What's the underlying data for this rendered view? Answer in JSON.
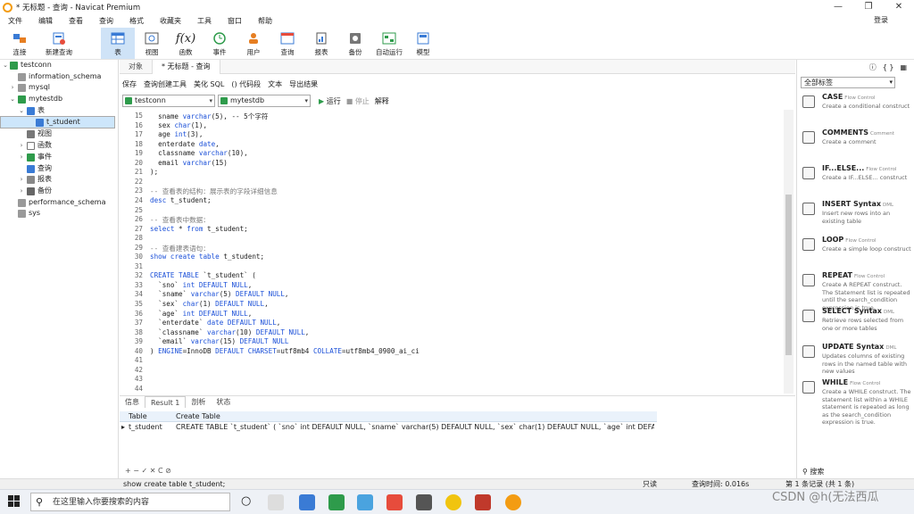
{
  "window": {
    "title": "* 无标题 - 查询 - Navicat Premium",
    "min": "—",
    "max": "❐",
    "close": "✕"
  },
  "menu": {
    "items": [
      "文件",
      "编辑",
      "查看",
      "查询",
      "格式",
      "收藏夹",
      "工具",
      "窗口",
      "帮助"
    ],
    "login": "登录"
  },
  "toolbar": {
    "items": [
      {
        "label": "连接",
        "icon": "connect-icon"
      },
      {
        "label": "新建查询",
        "icon": "new-query-icon"
      },
      {
        "label": "表",
        "icon": "table-icon"
      },
      {
        "label": "视图",
        "icon": "view-icon"
      },
      {
        "label": "函数",
        "icon": "function-icon"
      },
      {
        "label": "事件",
        "icon": "event-icon"
      },
      {
        "label": "用户",
        "icon": "user-icon"
      },
      {
        "label": "查询",
        "icon": "query-icon"
      },
      {
        "label": "报表",
        "icon": "report-icon"
      },
      {
        "label": "备份",
        "icon": "backup-icon"
      },
      {
        "label": "自动运行",
        "icon": "automation-icon"
      },
      {
        "label": "模型",
        "icon": "model-icon"
      }
    ]
  },
  "tree": [
    {
      "label": "testconn"
    },
    {
      "label": "information_schema"
    },
    {
      "label": "mysql"
    },
    {
      "label": "mytestdb"
    },
    {
      "label": "表"
    },
    {
      "label": "t_student"
    },
    {
      "label": "视图"
    },
    {
      "label": "函数"
    },
    {
      "label": "事件"
    },
    {
      "label": "查询"
    },
    {
      "label": "报表"
    },
    {
      "label": "备份"
    },
    {
      "label": "performance_schema"
    },
    {
      "label": "sys"
    }
  ],
  "doc_tabs": [
    "对象",
    "* 无标题 - 查询"
  ],
  "query_toolbar": [
    "保存",
    "查询创建工具",
    "美化 SQL",
    "() 代码段",
    "文本",
    "导出结果"
  ],
  "selectors": {
    "connection": "testconn",
    "database": "mytestdb",
    "run": "运行",
    "stop": "停止",
    "explain": "解释"
  },
  "editor": {
    "lines": [
      {
        "n": "15",
        "text": "  sname varchar(5), -- 5个字符"
      },
      {
        "n": "16",
        "text": "  sex char(1),"
      },
      {
        "n": "17",
        "text": "  age int(3),"
      },
      {
        "n": "18",
        "text": "  enterdate date,"
      },
      {
        "n": "19",
        "text": "  classname varchar(10),"
      },
      {
        "n": "20",
        "text": "  email varchar(15)"
      },
      {
        "n": "21",
        "text": ");"
      },
      {
        "n": "22",
        "text": ""
      },
      {
        "n": "23",
        "text": "-- 查看表的结构：展示表的字段详细信息"
      },
      {
        "n": "24",
        "text": "desc t_student;"
      },
      {
        "n": "25",
        "text": ""
      },
      {
        "n": "26",
        "text": "-- 查看表中数据："
      },
      {
        "n": "27",
        "text": "select * from t_student;"
      },
      {
        "n": "28",
        "text": ""
      },
      {
        "n": "29",
        "text": "-- 查看建表语句："
      },
      {
        "n": "30",
        "text": "show create table t_student;"
      },
      {
        "n": "31",
        "text": ""
      },
      {
        "n": "32",
        "text": "CREATE TABLE `t_student` ("
      },
      {
        "n": "33",
        "text": "  `sno` int DEFAULT NULL,"
      },
      {
        "n": "34",
        "text": "  `sname` varchar(5) DEFAULT NULL,"
      },
      {
        "n": "35",
        "text": "  `sex` char(1) DEFAULT NULL,"
      },
      {
        "n": "36",
        "text": "  `age` int DEFAULT NULL,"
      },
      {
        "n": "37",
        "text": "  `enterdate` date DEFAULT NULL,"
      },
      {
        "n": "38",
        "text": "  `classname` varchar(10) DEFAULT NULL,"
      },
      {
        "n": "39",
        "text": "  `email` varchar(15) DEFAULT NULL"
      },
      {
        "n": "40",
        "text": ") ENGINE=InnoDB DEFAULT CHARSET=utf8mb4 COLLATE=utf8mb4_0900_ai_ci"
      },
      {
        "n": "41",
        "text": ""
      },
      {
        "n": "42",
        "text": ""
      },
      {
        "n": "43",
        "text": ""
      },
      {
        "n": "44",
        "text": ""
      }
    ]
  },
  "result_tabs": [
    "信息",
    "Result 1",
    "剖析",
    "状态"
  ],
  "result_grid": {
    "headers": [
      "Table",
      "Create Table"
    ],
    "row": [
      "t_student",
      "CREATE TABLE `t_student` ( `sno` int DEFAULT NULL, `sname` varchar(5) DEFAULT NULL, `sex` char(1) DEFAULT NULL, `age` int DEFAULT NU"
    ]
  },
  "grid_footer": "+ − ✓ ✕ C ⊘",
  "status": {
    "sql": "show create table t_student;",
    "mode": "只读",
    "time": "查询时间: 0.016s",
    "records": "第 1 条记录 (共 1 条)"
  },
  "snippets": {
    "filter": "全部标签",
    "items": [
      {
        "name": "CASE",
        "type": "Flow Control",
        "desc": "Create a conditional construct"
      },
      {
        "name": "COMMENTS",
        "type": "Comment",
        "desc": "Create a comment"
      },
      {
        "name": "IF...ELSE...",
        "type": "Flow Control",
        "desc": "Create a IF...ELSE... construct"
      },
      {
        "name": "INSERT Syntax",
        "type": "DML",
        "desc": "Insert new rows into an existing table"
      },
      {
        "name": "LOOP",
        "type": "Flow Control",
        "desc": "Create a simple loop construct"
      },
      {
        "name": "REPEAT",
        "type": "Flow Control",
        "desc": "Create A REPEAT construct. The Statement list is repeated until the search_condition expression is true."
      },
      {
        "name": "SELECT Syntax",
        "type": "DML",
        "desc": "Retrieve rows selected from one or more tables"
      },
      {
        "name": "UPDATE Syntax",
        "type": "DML",
        "desc": "Updates columns of existing rows in the named table with new values"
      },
      {
        "name": "WHILE",
        "type": "Flow Control",
        "desc": "Create a WHILE construct. The statement list within a WHILE statement is repeated as long as the search_condition expression is true."
      }
    ],
    "search": "搜索"
  },
  "taskbar": {
    "search_placeholder": "在这里输入你要搜索的内容"
  },
  "watermark": "CSDN @h(无法西瓜",
  "colors": {
    "accent": "#1a4fd8",
    "selection": "#cde6fb",
    "green": "#2e9b4b"
  }
}
